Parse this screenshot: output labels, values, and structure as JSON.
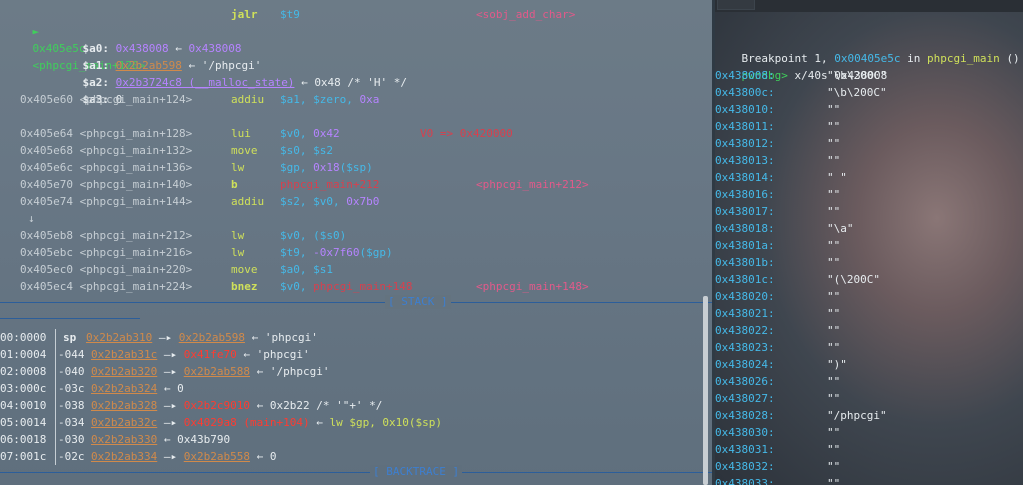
{
  "disasm": {
    "current": {
      "marker": "►",
      "addr": "0x405e5c",
      "func": "<phpcgi_main+120>",
      "mnemonic": "jalr",
      "operand": "$t9",
      "target": "<sobj_add_char>"
    },
    "args": [
      {
        "reg": "$a0:",
        "v1": "0x438008",
        "arrow": "←",
        "v2": "0x438008",
        "rest": ""
      },
      {
        "reg": "$a1:",
        "v1": "0x2b2ab598",
        "arrow": "←",
        "v2": "",
        "rest": "'/phpcgi'"
      },
      {
        "reg": "$a2:",
        "v1": "0x2b3724c8 (__malloc_state)",
        "arrow": "←",
        "v2": "",
        "rest": "0x48 /* 'H' */"
      },
      {
        "reg": "$a3:",
        "v1": "",
        "arrow": "",
        "v2": "",
        "rest": "0"
      }
    ],
    "rows": [
      {
        "addr": "0x405e60",
        "func": "<phpcgi_main+124>",
        "mn": "addiu",
        "ops": [
          {
            "t": "$a1,",
            "c": "c-blue"
          },
          {
            "t": " $zero,",
            "c": "c-blue"
          },
          {
            "t": " 0xa",
            "c": "c-purple"
          }
        ],
        "note": ""
      },
      {
        "addr": "0x405e64",
        "func": "<phpcgi_main+128>",
        "mn": "lui",
        "ops": [
          {
            "t": "$v0,",
            "c": "c-blue"
          },
          {
            "t": " 0x42",
            "c": "c-purple"
          }
        ],
        "note": "V0 => 0x420000"
      },
      {
        "addr": "0x405e68",
        "func": "<phpcgi_main+132>",
        "mn": "move",
        "ops": [
          {
            "t": "$s0,",
            "c": "c-blue"
          },
          {
            "t": " $s2",
            "c": "c-blue"
          }
        ],
        "note": ""
      },
      {
        "addr": "0x405e6c",
        "func": "<phpcgi_main+136>",
        "mn": "lw",
        "ops": [
          {
            "t": "$gp,",
            "c": "c-blue"
          },
          {
            "t": " 0x18",
            "c": "c-purple"
          },
          {
            "t": "($sp)",
            "c": "c-blue"
          }
        ],
        "note": ""
      },
      {
        "addr": "0x405e70",
        "func": "<phpcgi_main+140>",
        "mn": "b",
        "ops": [
          {
            "t": "phpcgi_main+212",
            "c": "c-dred"
          }
        ],
        "note": "<phpcgi_main+212>"
      },
      {
        "addr": "0x405e74",
        "func": "<phpcgi_main+144>",
        "mn": "addiu",
        "ops": [
          {
            "t": "$s2,",
            "c": "c-blue"
          },
          {
            "t": " $v0,",
            "c": "c-blue"
          },
          {
            "t": " 0x7b0",
            "c": "c-purple"
          }
        ],
        "note": ""
      },
      {
        "addr": "0x405eb8",
        "func": "<phpcgi_main+212>",
        "mn": "lw",
        "ops": [
          {
            "t": "$v0,",
            "c": "c-blue"
          },
          {
            "t": " ($s0)",
            "c": "c-blue"
          }
        ],
        "note": ""
      },
      {
        "addr": "0x405ebc",
        "func": "<phpcgi_main+216>",
        "mn": "lw",
        "ops": [
          {
            "t": "$t9,",
            "c": "c-blue"
          },
          {
            "t": " -0x7f60",
            "c": "c-purple"
          },
          {
            "t": "($gp)",
            "c": "c-blue"
          }
        ],
        "note": ""
      },
      {
        "addr": "0x405ec0",
        "func": "<phpcgi_main+220>",
        "mn": "move",
        "ops": [
          {
            "t": "$a0,",
            "c": "c-blue"
          },
          {
            "t": " $s1",
            "c": "c-blue"
          }
        ],
        "note": ""
      },
      {
        "addr": "0x405ec4",
        "func": "<phpcgi_main+224>",
        "mn": "bnez",
        "ops": [
          {
            "t": "$v0,",
            "c": "c-blue"
          },
          {
            "t": " phpcgi_main+148",
            "c": "c-dred"
          }
        ],
        "note": "<phpcgi_main+148>"
      }
    ],
    "jump_arrow": "↓"
  },
  "banners": {
    "stack": "[ STACK ]",
    "backtrace": "[ BACKTRACE ]"
  },
  "stack": [
    {
      "idx": "00:0000",
      "off": "sp",
      "a": "0x2b2ab310",
      "ar": "—▸",
      "b": "0x2b2ab598",
      "br": "←",
      "c": "'phpcgi'",
      "bc": "c-orange"
    },
    {
      "idx": "01:0004",
      "off": "-044",
      "a": "0x2b2ab31c",
      "ar": "—▸",
      "b": "0x41fe70",
      "br": "←",
      "c": "'phpcgi'",
      "bc": "c-red"
    },
    {
      "idx": "02:0008",
      "off": "-040",
      "a": "0x2b2ab320",
      "ar": "—▸",
      "b": "0x2b2ab588",
      "br": "←",
      "c": "'/phpcgi'",
      "bc": "c-orange"
    },
    {
      "idx": "03:000c",
      "off": "-03c",
      "a": "0x2b2ab324",
      "ar": "←",
      "b": "",
      "br": "",
      "c": "0",
      "bc": "c-orange"
    },
    {
      "idx": "04:0010",
      "off": "-038",
      "a": "0x2b2ab328",
      "ar": "—▸",
      "b": "0x2b2c9010",
      "br": "←",
      "c": "0x2b22 /* '\"+' */",
      "bc": "c-red"
    },
    {
      "idx": "05:0014",
      "off": "-034",
      "a": "0x2b2ab32c",
      "ar": "—▸",
      "b": "0x4029a8 (main+104)",
      "br": "←",
      "c": "lw $gp, 0x10($sp)",
      "bc": "c-red"
    },
    {
      "idx": "06:0018",
      "off": "-030",
      "a": "0x2b2ab330",
      "ar": "←",
      "b": "",
      "br": "",
      "c": "0x43b790",
      "bc": "c-orange"
    },
    {
      "idx": "07:001c",
      "off": "-02c",
      "a": "0x2b2ab334",
      "ar": "—▸",
      "b": "0x2b2ab558",
      "br": "←",
      "c": "0",
      "bc": "c-orange"
    }
  ],
  "gdb": {
    "breakpoint": {
      "prefix": "Breakpoint 1,",
      "addr": "0x00405e5c",
      "in": "in",
      "func": "phpcgi_main",
      "suffix": "()"
    },
    "prompt": "pwndbg>",
    "command": "x/40s 0x438008",
    "rows": [
      {
        "addr": "0x438008:",
        "val": "\"\\b\\200C\""
      },
      {
        "addr": "0x43800c:",
        "val": "\"\\b\\200C\""
      },
      {
        "addr": "0x438010:",
        "val": "\"\""
      },
      {
        "addr": "0x438011:",
        "val": "\"\""
      },
      {
        "addr": "0x438012:",
        "val": "\"\""
      },
      {
        "addr": "0x438013:",
        "val": "\"\""
      },
      {
        "addr": "0x438014:",
        "val": "\" \""
      },
      {
        "addr": "0x438016:",
        "val": "\"\""
      },
      {
        "addr": "0x438017:",
        "val": "\"\""
      },
      {
        "addr": "0x438018:",
        "val": "\"\\a\""
      },
      {
        "addr": "0x43801a:",
        "val": "\"\""
      },
      {
        "addr": "0x43801b:",
        "val": "\"\""
      },
      {
        "addr": "0x43801c:",
        "val": "\"(\\200C\""
      },
      {
        "addr": "0x438020:",
        "val": "\"\""
      },
      {
        "addr": "0x438021:",
        "val": "\"\""
      },
      {
        "addr": "0x438022:",
        "val": "\"\""
      },
      {
        "addr": "0x438023:",
        "val": "\"\""
      },
      {
        "addr": "0x438024:",
        "val": "\")\""
      },
      {
        "addr": "0x438026:",
        "val": "\"\""
      },
      {
        "addr": "0x438027:",
        "val": "\"\""
      },
      {
        "addr": "0x438028:",
        "val": "\"/phpcgi\""
      },
      {
        "addr": "0x438030:",
        "val": "\"\""
      },
      {
        "addr": "0x438031:",
        "val": "\"\""
      },
      {
        "addr": "0x438032:",
        "val": "\"\""
      },
      {
        "addr": "0x438033:",
        "val": "\"\""
      }
    ]
  }
}
